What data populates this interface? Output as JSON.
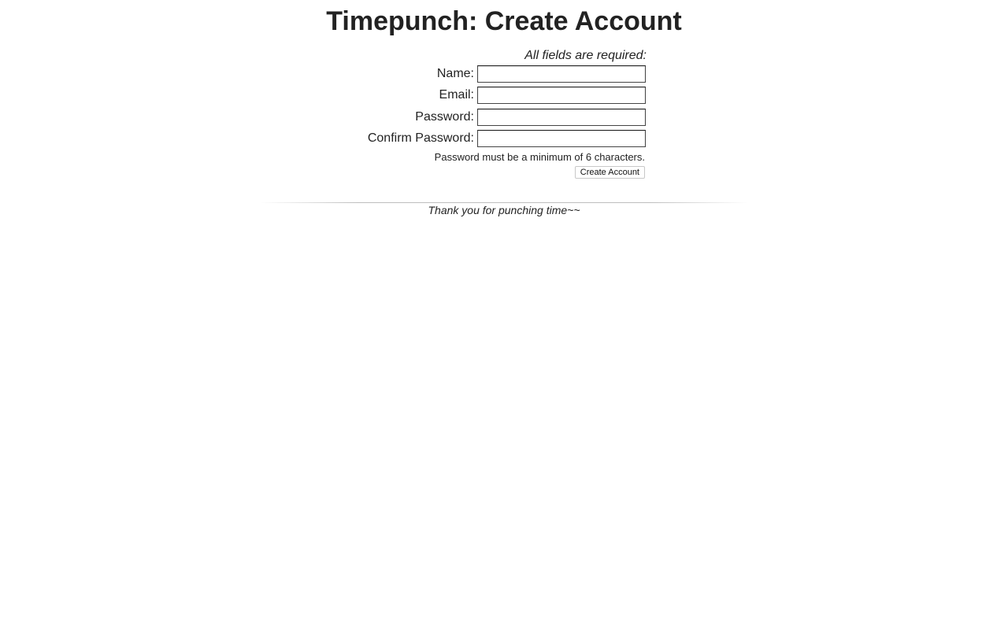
{
  "page": {
    "title": "Timepunch: Create Account"
  },
  "form": {
    "required_note": "All fields are required:",
    "fields": [
      {
        "label": "Name:",
        "value": "",
        "placeholder": ""
      },
      {
        "label": "Email:",
        "value": "",
        "placeholder": ""
      },
      {
        "label": "Password:",
        "value": "",
        "placeholder": ""
      },
      {
        "label": "Confirm Password:",
        "value": "",
        "placeholder": ""
      }
    ],
    "password_hint": "Password must be a minimum of 6 characters.",
    "submit_label": "Create Account"
  },
  "footer": {
    "text": "Thank you for punching time~~"
  }
}
